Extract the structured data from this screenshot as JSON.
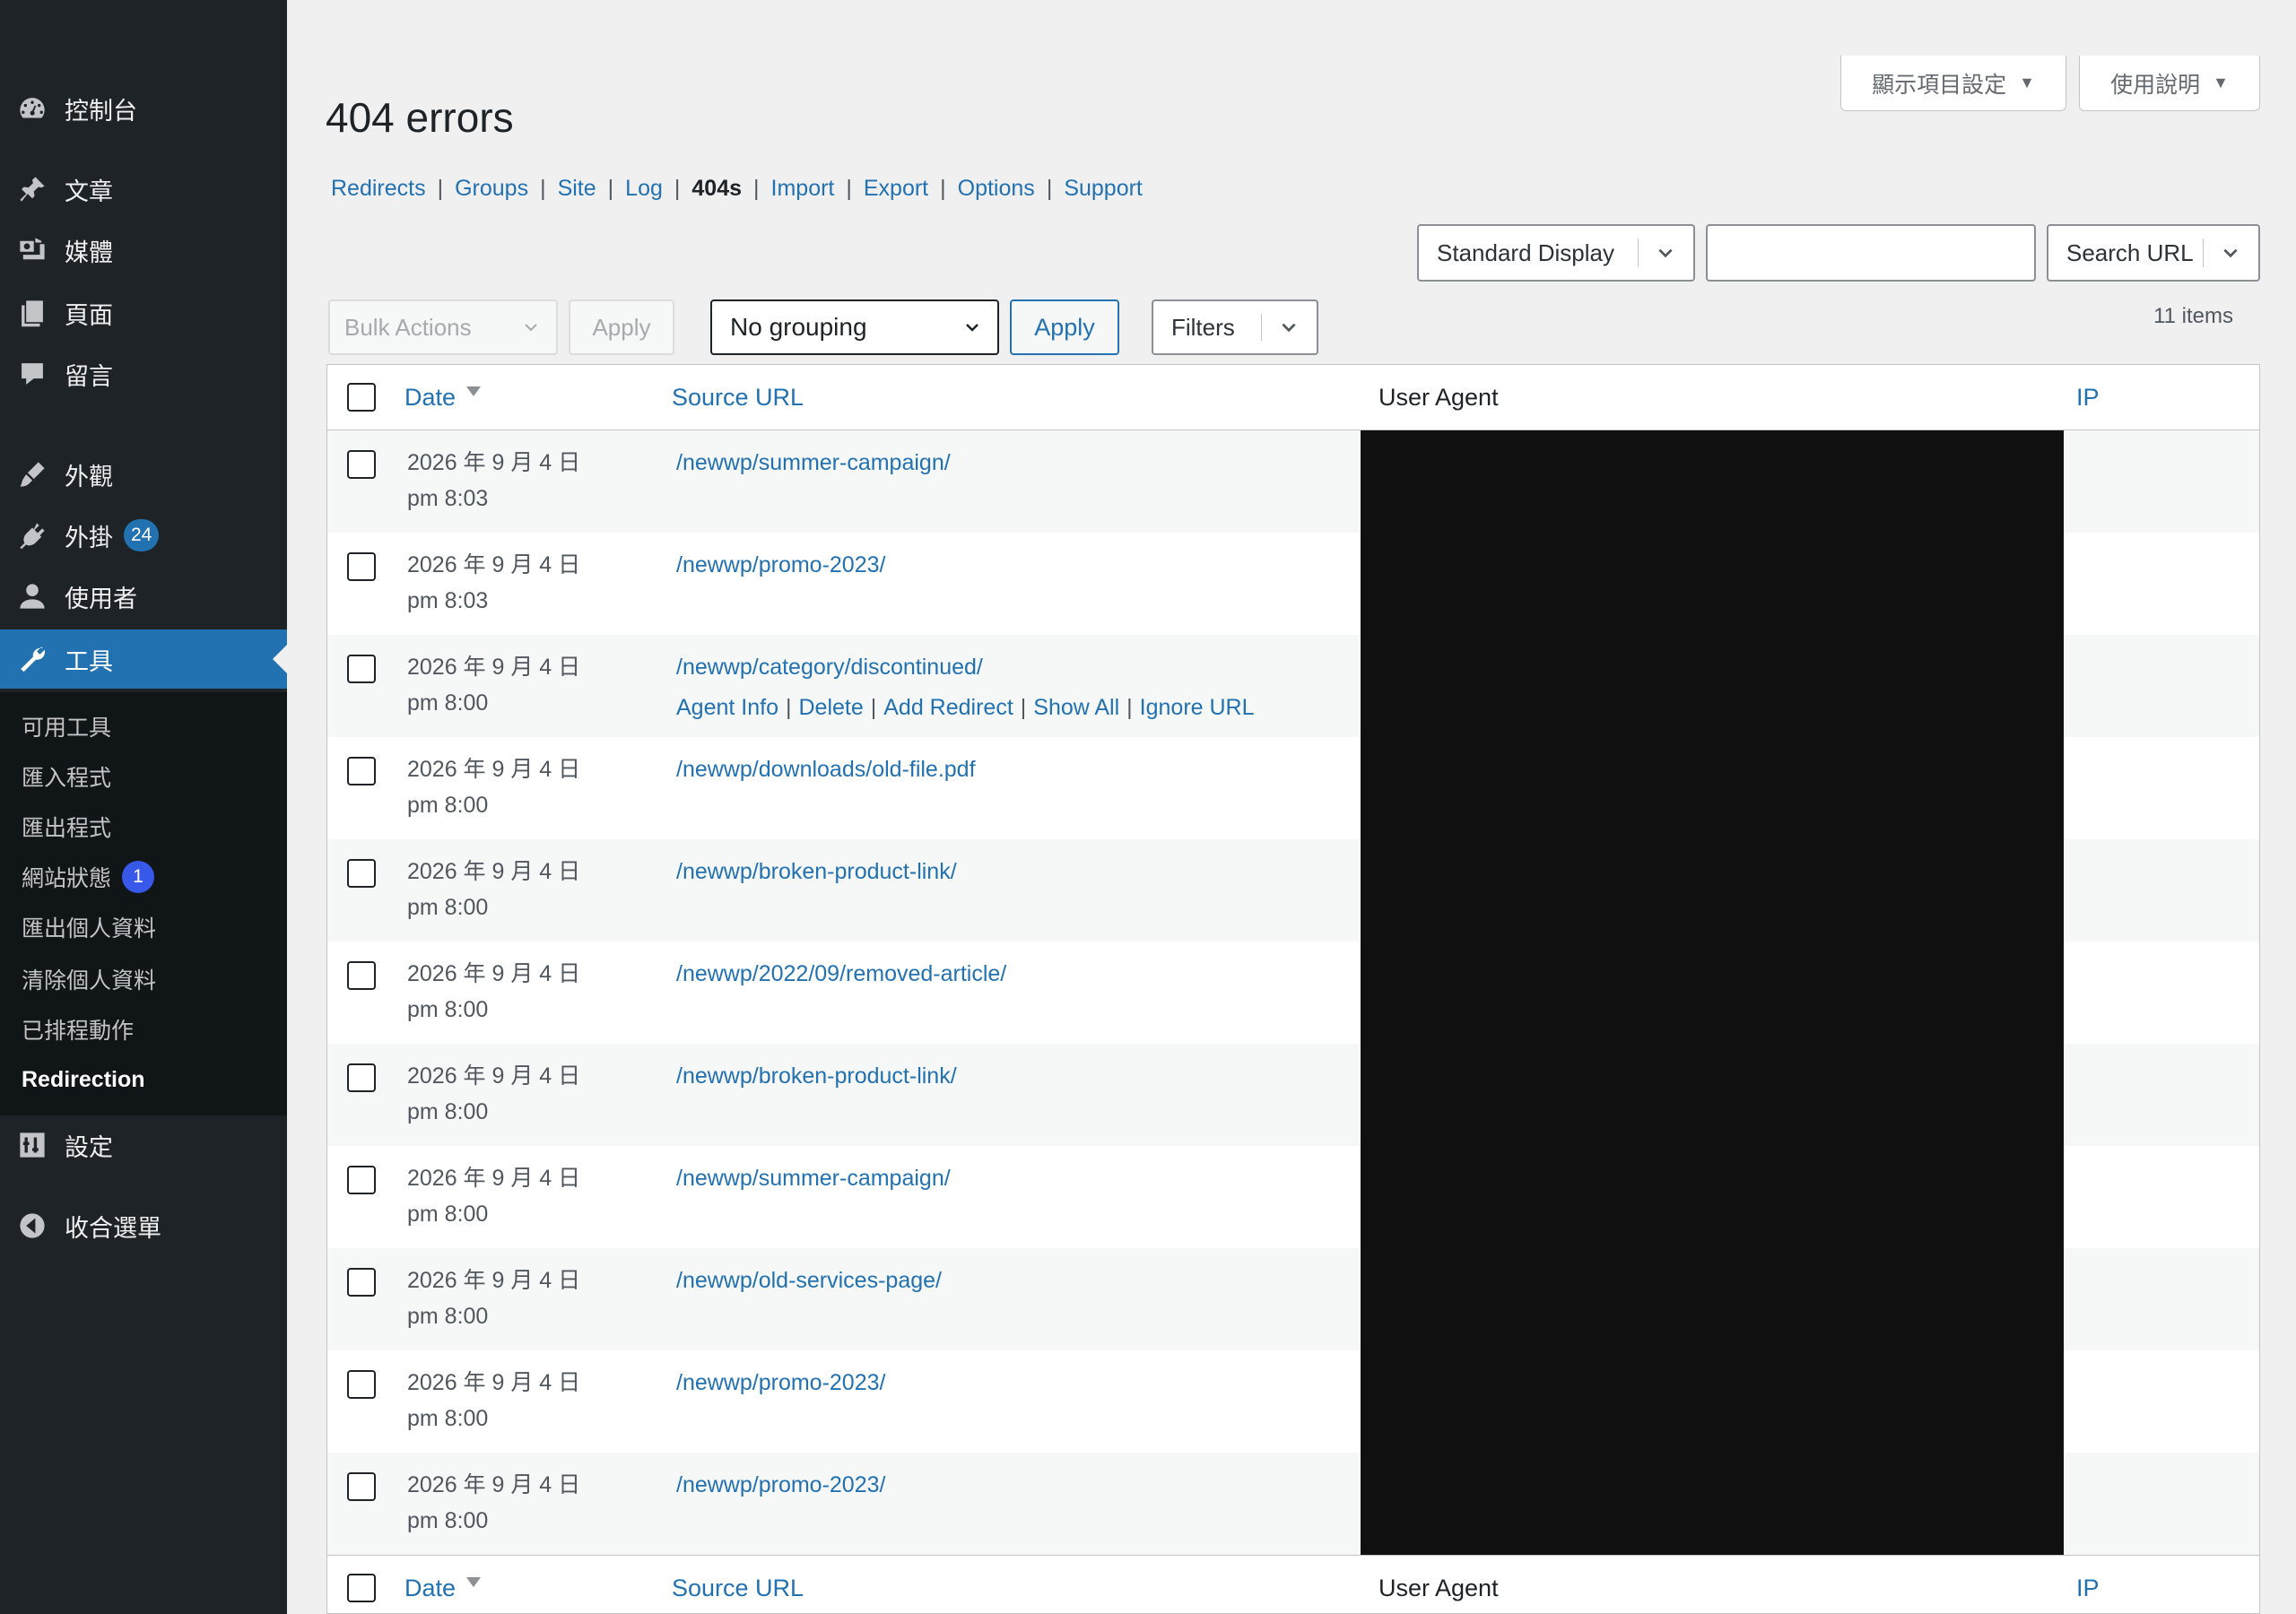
{
  "sidebar": {
    "items": [
      {
        "label": "控制台",
        "icon": "dashboard-icon"
      },
      {
        "label": "文章",
        "icon": "pin-icon"
      },
      {
        "label": "媒體",
        "icon": "media-icon"
      },
      {
        "label": "頁面",
        "icon": "page-icon"
      },
      {
        "label": "留言",
        "icon": "comment-icon"
      },
      {
        "label": "外觀",
        "icon": "brush-icon"
      },
      {
        "label": "外掛",
        "icon": "plugin-icon",
        "badge": "24"
      },
      {
        "label": "使用者",
        "icon": "user-icon"
      },
      {
        "label": "工具",
        "icon": "wrench-icon"
      },
      {
        "label": "設定",
        "icon": "settings-icon"
      },
      {
        "label": "收合選單",
        "icon": "collapse-icon"
      }
    ],
    "submenu": [
      {
        "label": "可用工具"
      },
      {
        "label": "匯入程式"
      },
      {
        "label": "匯出程式"
      },
      {
        "label": "網站狀態",
        "badge": "1"
      },
      {
        "label": "匯出個人資料"
      },
      {
        "label": "清除個人資料"
      },
      {
        "label": "已排程動作"
      },
      {
        "label": "Redirection"
      }
    ]
  },
  "screen_options": {
    "label": "顯示項目設定"
  },
  "help": {
    "label": "使用說明"
  },
  "page": {
    "title": "404 errors"
  },
  "subnav": [
    {
      "label": "Redirects"
    },
    {
      "label": "Groups"
    },
    {
      "label": "Site"
    },
    {
      "label": "Log"
    },
    {
      "label": "404s",
      "current": true
    },
    {
      "label": "Import"
    },
    {
      "label": "Export"
    },
    {
      "label": "Options"
    },
    {
      "label": "Support"
    }
  ],
  "display_select": {
    "value": "Standard Display"
  },
  "search": {
    "value": "",
    "button": "Search URL"
  },
  "bulk": {
    "value": "Bulk Actions",
    "apply": "Apply"
  },
  "grouping": {
    "value": "No grouping",
    "apply": "Apply"
  },
  "filters": {
    "label": "Filters"
  },
  "items_count": "11 items",
  "table": {
    "columns": {
      "date": "Date",
      "source": "Source URL",
      "agent": "User Agent",
      "ip": "IP"
    },
    "row_actions": [
      "Agent Info",
      "Delete",
      "Add Redirect",
      "Show All",
      "Ignore URL"
    ],
    "rows": [
      {
        "date": "2026 年 9 月 4 日",
        "time": "pm 8:03",
        "url": "/newwp/summer-campaign/"
      },
      {
        "date": "2026 年 9 月 4 日",
        "time": "pm 8:03",
        "url": "/newwp/promo-2023/"
      },
      {
        "date": "2026 年 9 月 4 日",
        "time": "pm 8:00",
        "url": "/newwp/category/discontinued/"
      },
      {
        "date": "2026 年 9 月 4 日",
        "time": "pm 8:00",
        "url": "/newwp/downloads/old-file.pdf"
      },
      {
        "date": "2026 年 9 月 4 日",
        "time": "pm 8:00",
        "url": "/newwp/broken-product-link/"
      },
      {
        "date": "2026 年 9 月 4 日",
        "time": "pm 8:00",
        "url": "/newwp/2022/09/removed-article/"
      },
      {
        "date": "2026 年 9 月 4 日",
        "time": "pm 8:00",
        "url": "/newwp/broken-product-link/"
      },
      {
        "date": "2026 年 9 月 4 日",
        "time": "pm 8:00",
        "url": "/newwp/summer-campaign/"
      },
      {
        "date": "2026 年 9 月 4 日",
        "time": "pm 8:00",
        "url": "/newwp/old-services-page/"
      },
      {
        "date": "2026 年 9 月 4 日",
        "time": "pm 8:00",
        "url": "/newwp/promo-2023/"
      },
      {
        "date": "2026 年 9 月 4 日",
        "time": "pm 8:00",
        "url": "/newwp/promo-2023/"
      }
    ]
  }
}
